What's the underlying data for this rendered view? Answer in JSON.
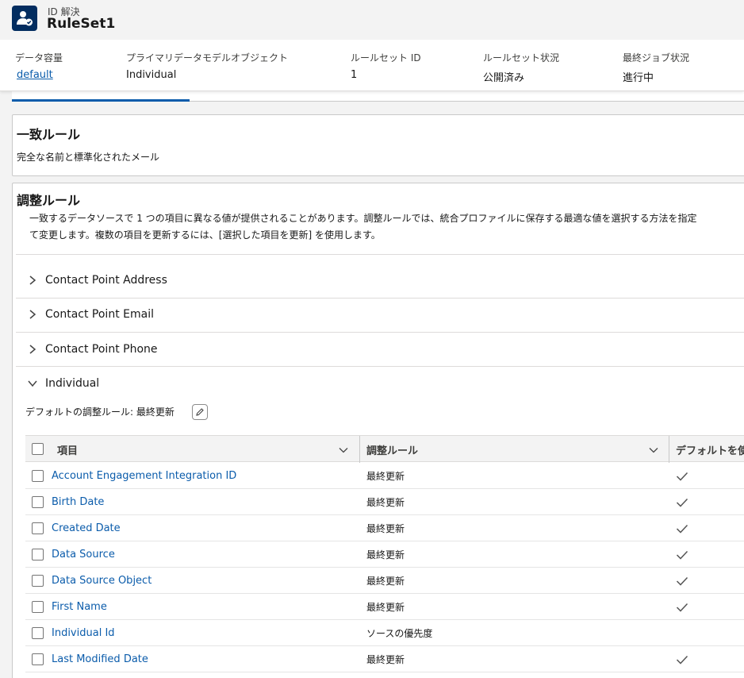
{
  "header": {
    "object_label": "ID 解決",
    "title": "RuleSet1",
    "fields": [
      {
        "label": "データ容量",
        "value": "default",
        "is_link": true
      },
      {
        "label": "プライマリデータモデルオブジェクト",
        "value": "Individual"
      },
      {
        "label": "ルールセット ID",
        "value": "1"
      },
      {
        "label": "ルールセット状況",
        "value": "公開済み"
      },
      {
        "label": "最終ジョブ状況",
        "value": "進行中"
      }
    ]
  },
  "match_rules": {
    "title": "一致ルール",
    "description": "完全な名前と標準化されたメール"
  },
  "reconciliation": {
    "title": "調整ルール",
    "description_line1": "一致するデータソースで 1 つの項目に異なる値が提供されることがあります。調整ルールでは、統合プロファイルに保存する最適な値を選択する方法を指定",
    "description_line2": "て変更します。複数の項目を更新するには、[選択した項目を更新] を使用します。",
    "sections": [
      {
        "label": "Contact Point Address",
        "expanded": false
      },
      {
        "label": "Contact Point Email",
        "expanded": false
      },
      {
        "label": "Contact Point Phone",
        "expanded": false
      },
      {
        "label": "Individual",
        "expanded": true
      }
    ],
    "default_rule_text": "デフォルトの調整ルール: 最終更新"
  },
  "table": {
    "columns": [
      "項目",
      "調整ルール",
      "デフォルトを使"
    ],
    "rows": [
      {
        "field": "Account Engagement Integration ID",
        "rule": "最終更新",
        "default": true
      },
      {
        "field": "Birth Date",
        "rule": "最終更新",
        "default": true
      },
      {
        "field": "Created Date",
        "rule": "最終更新",
        "default": true
      },
      {
        "field": "Data Source",
        "rule": "最終更新",
        "default": true
      },
      {
        "field": "Data Source Object",
        "rule": "最終更新",
        "default": true
      },
      {
        "field": "First Name",
        "rule": "最終更新",
        "default": true
      },
      {
        "field": "Individual Id",
        "rule": "ソースの優先度",
        "default": false
      },
      {
        "field": "Last Modified Date",
        "rule": "最終更新",
        "default": true
      }
    ]
  },
  "colors": {
    "brand": "#032d60",
    "link": "#0b5cab",
    "border": "#c9c9c9"
  }
}
